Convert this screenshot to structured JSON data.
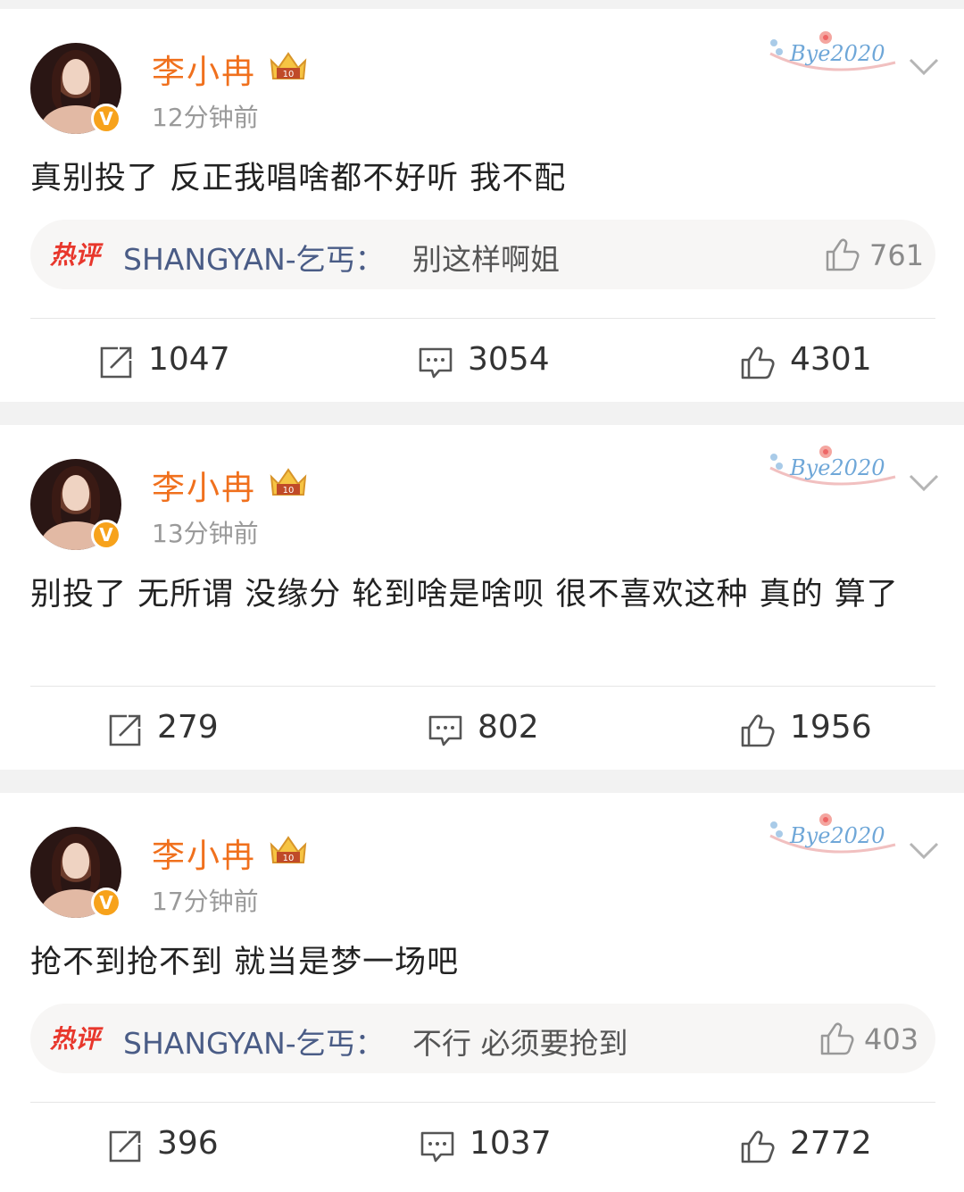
{
  "posts": [
    {
      "author": "李小冉",
      "time": "12分钟前",
      "deco_text": "Bye2020",
      "content": "真别投了 反正我唱啥都不好听 我不配",
      "hot_comment": {
        "tag": "热评",
        "user": "SHANGYAN-乞丐",
        "text": "别这样啊姐",
        "likes": "761"
      },
      "actions": {
        "repost": "1047",
        "comment": "3054",
        "like": "4301"
      }
    },
    {
      "author": "李小冉",
      "time": "13分钟前",
      "deco_text": "Bye2020",
      "content": "别投了 无所谓 没缘分 轮到啥是啥呗 很不喜欢这种 真的  算了",
      "actions": {
        "repost": "279",
        "comment": "802",
        "like": "1956"
      }
    },
    {
      "author": "李小冉",
      "time": "17分钟前",
      "deco_text": "Bye2020",
      "content": "抢不到抢不到 就当是梦一场吧",
      "hot_comment": {
        "tag": "热评",
        "user": "SHANGYAN-乞丐",
        "text": "不行 必须要抢到",
        "likes": "403"
      },
      "actions": {
        "repost": "396",
        "comment": "1037",
        "like": "2772"
      }
    }
  ],
  "icons": {
    "verified": "verified-v-icon",
    "crown": "crown-badge-icon",
    "chevron": "chevron-down-icon",
    "repost": "repost-icon",
    "comment": "comment-icon",
    "like": "thumbs-up-icon"
  },
  "colors": {
    "name": "#f0701d",
    "hot_tag": "#e8372c",
    "comment_user": "#4a5c86",
    "verified": "#f7a21b"
  }
}
